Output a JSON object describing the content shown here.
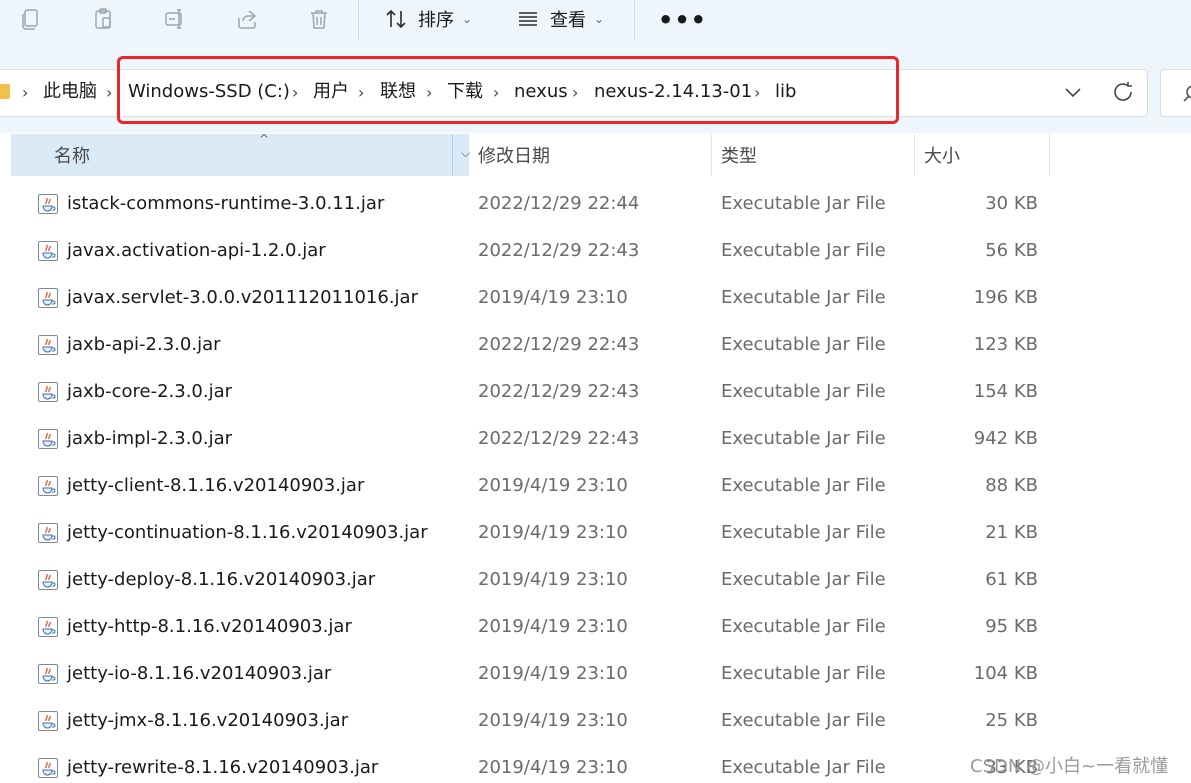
{
  "toolbar": {
    "icons": [
      "copy-icon",
      "paste-icon",
      "rename-icon",
      "share-icon",
      "delete-icon"
    ],
    "sort_label": "排序",
    "view_label": "查看",
    "more_label": "•••"
  },
  "address": {
    "crumbs": [
      "此电脑",
      "Windows-SSD (C:)",
      "用户",
      "联想",
      "下载",
      "nexus",
      "nexus-2.14.13-01",
      "lib"
    ],
    "separator": "›"
  },
  "columns": {
    "name": "名称",
    "date": "修改日期",
    "type": "类型",
    "size": "大小"
  },
  "files": [
    {
      "name": "istack-commons-runtime-3.0.11.jar",
      "date": "2022/12/29 22:44",
      "type": "Executable Jar File",
      "size": "30 KB"
    },
    {
      "name": "javax.activation-api-1.2.0.jar",
      "date": "2022/12/29 22:43",
      "type": "Executable Jar File",
      "size": "56 KB"
    },
    {
      "name": "javax.servlet-3.0.0.v201112011016.jar",
      "date": "2019/4/19 23:10",
      "type": "Executable Jar File",
      "size": "196 KB"
    },
    {
      "name": "jaxb-api-2.3.0.jar",
      "date": "2022/12/29 22:43",
      "type": "Executable Jar File",
      "size": "123 KB"
    },
    {
      "name": "jaxb-core-2.3.0.jar",
      "date": "2022/12/29 22:43",
      "type": "Executable Jar File",
      "size": "154 KB"
    },
    {
      "name": "jaxb-impl-2.3.0.jar",
      "date": "2022/12/29 22:43",
      "type": "Executable Jar File",
      "size": "942 KB"
    },
    {
      "name": "jetty-client-8.1.16.v20140903.jar",
      "date": "2019/4/19 23:10",
      "type": "Executable Jar File",
      "size": "88 KB"
    },
    {
      "name": "jetty-continuation-8.1.16.v20140903.jar",
      "date": "2019/4/19 23:10",
      "type": "Executable Jar File",
      "size": "21 KB"
    },
    {
      "name": "jetty-deploy-8.1.16.v20140903.jar",
      "date": "2019/4/19 23:10",
      "type": "Executable Jar File",
      "size": "61 KB"
    },
    {
      "name": "jetty-http-8.1.16.v20140903.jar",
      "date": "2019/4/19 23:10",
      "type": "Executable Jar File",
      "size": "95 KB"
    },
    {
      "name": "jetty-io-8.1.16.v20140903.jar",
      "date": "2019/4/19 23:10",
      "type": "Executable Jar File",
      "size": "104 KB"
    },
    {
      "name": "jetty-jmx-8.1.16.v20140903.jar",
      "date": "2019/4/19 23:10",
      "type": "Executable Jar File",
      "size": "25 KB"
    },
    {
      "name": "jetty-rewrite-8.1.16.v20140903.jar",
      "date": "2019/4/19 23:10",
      "type": "Executable Jar File",
      "size": "33 KB"
    }
  ],
  "watermark": "CSDN @小白~一看就懂",
  "colors": {
    "toolbar_bg": "#eff6fb",
    "highlight": "#e8262c",
    "header_selected": "#dbeaf7"
  }
}
